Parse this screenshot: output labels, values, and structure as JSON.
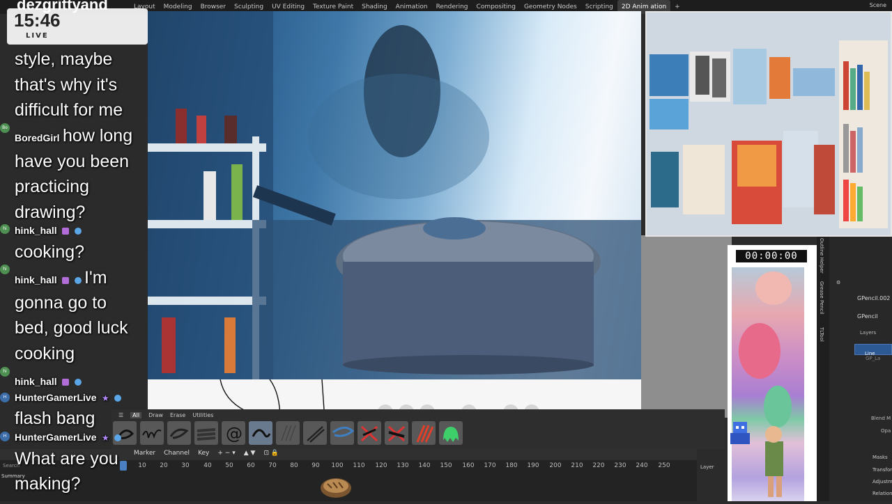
{
  "channel_name": "dezgrittyand",
  "clock": {
    "time": "15:46",
    "status": "LIVE"
  },
  "blender": {
    "workspace_tabs": [
      "Layout",
      "Modeling",
      "Browser",
      "Sculpting",
      "UV Editing",
      "Texture Paint",
      "Shading",
      "Animation",
      "Rendering",
      "Compositing",
      "Geometry Nodes",
      "Scripting",
      "2D Anim ation"
    ],
    "active_tab": "2D Anim ation",
    "scene_label": "Scene",
    "brush_tabs": [
      "All",
      "Draw",
      "Erase",
      "Utilities"
    ],
    "timeline_menu": [
      "Marker",
      "Channel",
      "Key"
    ],
    "frame_ticks": [
      "10",
      "20",
      "30",
      "40",
      "50",
      "60",
      "70",
      "80",
      "90",
      "100",
      "110",
      "120",
      "130",
      "140",
      "150",
      "160",
      "170",
      "180",
      "190",
      "200",
      "210",
      "220",
      "230",
      "240",
      "250"
    ],
    "summary_label": "Summary",
    "search_placeholder": "Search",
    "side_tabs": [
      "Outline Helper",
      "Grease Pencil",
      "TLTool"
    ],
    "object_name_1": "GPencil.002",
    "object_name_2": "GPencil",
    "layers_label": "Layers",
    "layer_active": "Line",
    "layer_other": "GP_La",
    "blend_mode_label": "Blend M",
    "opacity_label": "Opa",
    "panel_items": [
      "Masks",
      "Transform",
      "Adjustment",
      "Relations"
    ],
    "layer_header": "Layer",
    "timer": "00:00:00"
  },
  "chat": {
    "messages": [
      {
        "kind": "text",
        "text": "style, maybe"
      },
      {
        "kind": "text",
        "text": "that's why it's"
      },
      {
        "kind": "text",
        "text": "difficult for me"
      },
      {
        "kind": "user",
        "user": "BoredGirl",
        "text": "how long"
      },
      {
        "kind": "text",
        "text": "have you been"
      },
      {
        "kind": "text",
        "text": "practicing"
      },
      {
        "kind": "text",
        "text": "drawing?"
      },
      {
        "kind": "user",
        "user": "hink_hall",
        "text": ""
      },
      {
        "kind": "text",
        "text": "cooking?"
      },
      {
        "kind": "user",
        "user": "hink_hall",
        "text": "I'm"
      },
      {
        "kind": "text",
        "text": "gonna go to"
      },
      {
        "kind": "text",
        "text": "bed, good luck"
      },
      {
        "kind": "text",
        "text": "cooking"
      },
      {
        "kind": "user",
        "user": "hink_hall",
        "text": ""
      },
      {
        "kind": "user",
        "user": "HunterGamerLive",
        "text": ""
      },
      {
        "kind": "text",
        "text": "flash bang"
      },
      {
        "kind": "user",
        "user": "HunterGamerLive",
        "text": ""
      },
      {
        "kind": "text",
        "text": "What are you"
      },
      {
        "kind": "text",
        "text": "making?"
      }
    ]
  },
  "colors": {
    "accent": "#4a7fc1",
    "chat_text": "#ffffff",
    "timeline_bg": "#232323"
  }
}
